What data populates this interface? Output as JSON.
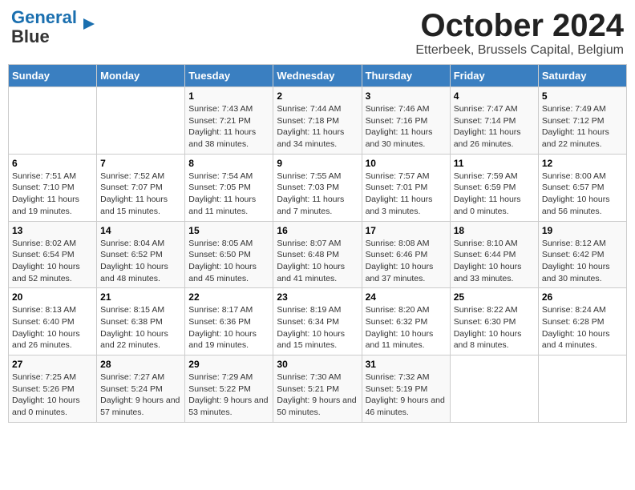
{
  "header": {
    "logo_line1": "General",
    "logo_line2": "Blue",
    "title": "October 2024",
    "subtitle": "Etterbeek, Brussels Capital, Belgium"
  },
  "days_of_week": [
    "Sunday",
    "Monday",
    "Tuesday",
    "Wednesday",
    "Thursday",
    "Friday",
    "Saturday"
  ],
  "weeks": [
    [
      {
        "day": "",
        "info": ""
      },
      {
        "day": "",
        "info": ""
      },
      {
        "day": "1",
        "info": "Sunrise: 7:43 AM\nSunset: 7:21 PM\nDaylight: 11 hours and 38 minutes."
      },
      {
        "day": "2",
        "info": "Sunrise: 7:44 AM\nSunset: 7:18 PM\nDaylight: 11 hours and 34 minutes."
      },
      {
        "day": "3",
        "info": "Sunrise: 7:46 AM\nSunset: 7:16 PM\nDaylight: 11 hours and 30 minutes."
      },
      {
        "day": "4",
        "info": "Sunrise: 7:47 AM\nSunset: 7:14 PM\nDaylight: 11 hours and 26 minutes."
      },
      {
        "day": "5",
        "info": "Sunrise: 7:49 AM\nSunset: 7:12 PM\nDaylight: 11 hours and 22 minutes."
      }
    ],
    [
      {
        "day": "6",
        "info": "Sunrise: 7:51 AM\nSunset: 7:10 PM\nDaylight: 11 hours and 19 minutes."
      },
      {
        "day": "7",
        "info": "Sunrise: 7:52 AM\nSunset: 7:07 PM\nDaylight: 11 hours and 15 minutes."
      },
      {
        "day": "8",
        "info": "Sunrise: 7:54 AM\nSunset: 7:05 PM\nDaylight: 11 hours and 11 minutes."
      },
      {
        "day": "9",
        "info": "Sunrise: 7:55 AM\nSunset: 7:03 PM\nDaylight: 11 hours and 7 minutes."
      },
      {
        "day": "10",
        "info": "Sunrise: 7:57 AM\nSunset: 7:01 PM\nDaylight: 11 hours and 3 minutes."
      },
      {
        "day": "11",
        "info": "Sunrise: 7:59 AM\nSunset: 6:59 PM\nDaylight: 11 hours and 0 minutes."
      },
      {
        "day": "12",
        "info": "Sunrise: 8:00 AM\nSunset: 6:57 PM\nDaylight: 10 hours and 56 minutes."
      }
    ],
    [
      {
        "day": "13",
        "info": "Sunrise: 8:02 AM\nSunset: 6:54 PM\nDaylight: 10 hours and 52 minutes."
      },
      {
        "day": "14",
        "info": "Sunrise: 8:04 AM\nSunset: 6:52 PM\nDaylight: 10 hours and 48 minutes."
      },
      {
        "day": "15",
        "info": "Sunrise: 8:05 AM\nSunset: 6:50 PM\nDaylight: 10 hours and 45 minutes."
      },
      {
        "day": "16",
        "info": "Sunrise: 8:07 AM\nSunset: 6:48 PM\nDaylight: 10 hours and 41 minutes."
      },
      {
        "day": "17",
        "info": "Sunrise: 8:08 AM\nSunset: 6:46 PM\nDaylight: 10 hours and 37 minutes."
      },
      {
        "day": "18",
        "info": "Sunrise: 8:10 AM\nSunset: 6:44 PM\nDaylight: 10 hours and 33 minutes."
      },
      {
        "day": "19",
        "info": "Sunrise: 8:12 AM\nSunset: 6:42 PM\nDaylight: 10 hours and 30 minutes."
      }
    ],
    [
      {
        "day": "20",
        "info": "Sunrise: 8:13 AM\nSunset: 6:40 PM\nDaylight: 10 hours and 26 minutes."
      },
      {
        "day": "21",
        "info": "Sunrise: 8:15 AM\nSunset: 6:38 PM\nDaylight: 10 hours and 22 minutes."
      },
      {
        "day": "22",
        "info": "Sunrise: 8:17 AM\nSunset: 6:36 PM\nDaylight: 10 hours and 19 minutes."
      },
      {
        "day": "23",
        "info": "Sunrise: 8:19 AM\nSunset: 6:34 PM\nDaylight: 10 hours and 15 minutes."
      },
      {
        "day": "24",
        "info": "Sunrise: 8:20 AM\nSunset: 6:32 PM\nDaylight: 10 hours and 11 minutes."
      },
      {
        "day": "25",
        "info": "Sunrise: 8:22 AM\nSunset: 6:30 PM\nDaylight: 10 hours and 8 minutes."
      },
      {
        "day": "26",
        "info": "Sunrise: 8:24 AM\nSunset: 6:28 PM\nDaylight: 10 hours and 4 minutes."
      }
    ],
    [
      {
        "day": "27",
        "info": "Sunrise: 7:25 AM\nSunset: 5:26 PM\nDaylight: 10 hours and 0 minutes."
      },
      {
        "day": "28",
        "info": "Sunrise: 7:27 AM\nSunset: 5:24 PM\nDaylight: 9 hours and 57 minutes."
      },
      {
        "day": "29",
        "info": "Sunrise: 7:29 AM\nSunset: 5:22 PM\nDaylight: 9 hours and 53 minutes."
      },
      {
        "day": "30",
        "info": "Sunrise: 7:30 AM\nSunset: 5:21 PM\nDaylight: 9 hours and 50 minutes."
      },
      {
        "day": "31",
        "info": "Sunrise: 7:32 AM\nSunset: 5:19 PM\nDaylight: 9 hours and 46 minutes."
      },
      {
        "day": "",
        "info": ""
      },
      {
        "day": "",
        "info": ""
      }
    ]
  ]
}
